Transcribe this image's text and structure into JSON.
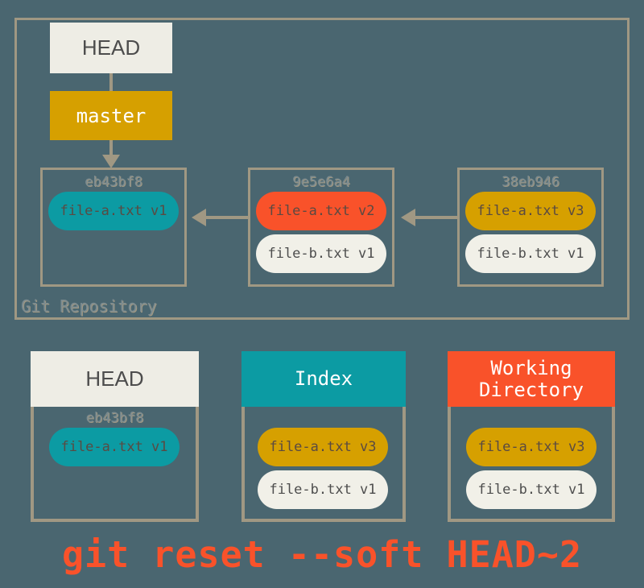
{
  "background_color": "#4a6670",
  "palette": {
    "border": "#a09883",
    "teal": "#0c9ba3",
    "gold": "#d6a000",
    "red": "#f9522a",
    "white": "#f1f0e8",
    "sha_text": "#7d8c90"
  },
  "repository": {
    "label": "Git Repository",
    "pointers": {
      "head": "HEAD",
      "branch": "master"
    },
    "commits": [
      {
        "sha": "eb43bf8",
        "files": [
          {
            "name": "file-a.txt v1",
            "color": "teal"
          }
        ]
      },
      {
        "sha": "9e5e6a4",
        "files": [
          {
            "name": "file-a.txt v2",
            "color": "red"
          },
          {
            "name": "file-b.txt v1",
            "color": "white"
          }
        ]
      },
      {
        "sha": "38eb946",
        "files": [
          {
            "name": "file-a.txt v3",
            "color": "gold"
          },
          {
            "name": "file-b.txt v1",
            "color": "white"
          }
        ]
      }
    ]
  },
  "panels": [
    {
      "title": "HEAD",
      "header_style": "white",
      "sha": "eb43bf8",
      "files": [
        {
          "name": "file-a.txt v1",
          "color": "teal"
        }
      ]
    },
    {
      "title": "Index",
      "header_style": "teal",
      "sha": "",
      "files": [
        {
          "name": "file-a.txt v3",
          "color": "gold"
        },
        {
          "name": "file-b.txt v1",
          "color": "white"
        }
      ]
    },
    {
      "title_line1": "Working",
      "title_line2": "Directory",
      "header_style": "red",
      "sha": "",
      "files": [
        {
          "name": "file-a.txt v3",
          "color": "gold"
        },
        {
          "name": "file-b.txt v1",
          "color": "white"
        }
      ]
    }
  ],
  "command": "git reset --soft HEAD~2"
}
